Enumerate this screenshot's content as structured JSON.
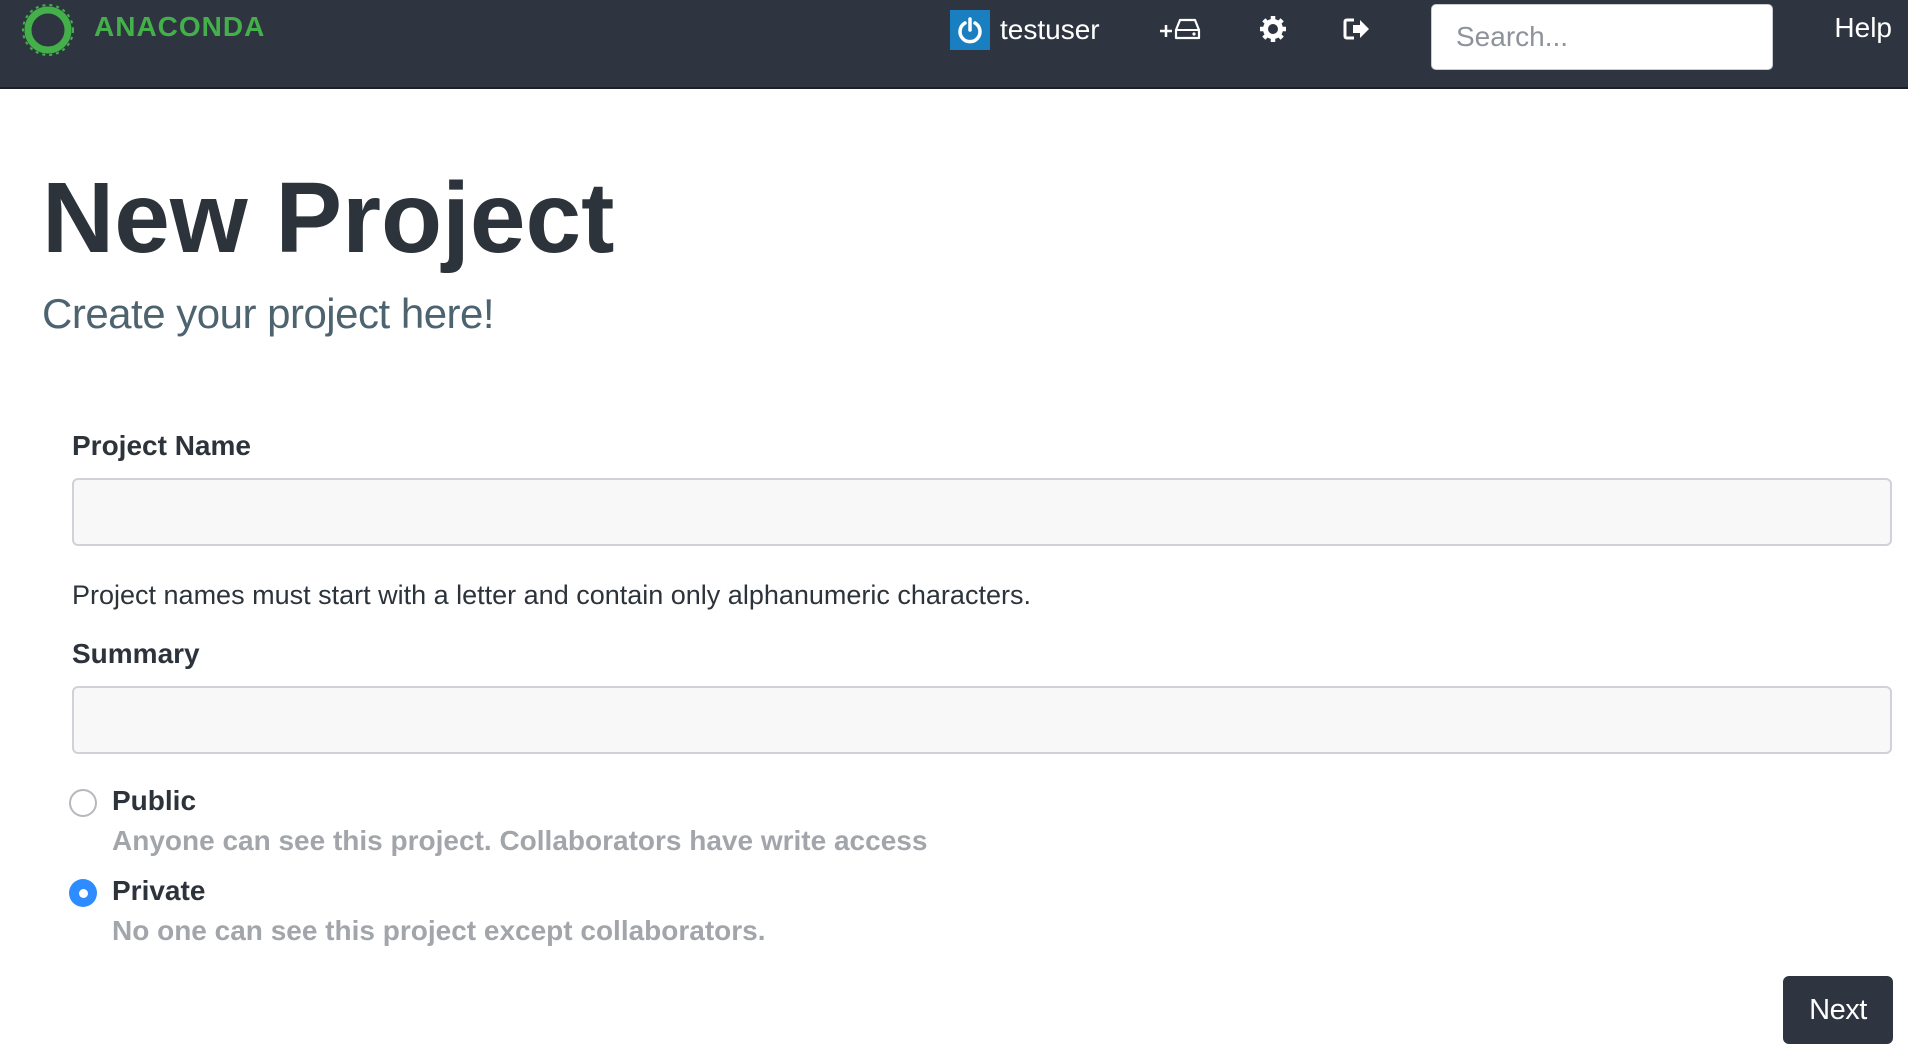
{
  "header": {
    "brand": "ANACONDA",
    "username": "testuser",
    "icons": {
      "logo": "anaconda-ring-logo",
      "avatar": "power-icon",
      "create": "add-drive-icon",
      "settings": "gear-icon",
      "logout": "sign-out-icon"
    },
    "search_placeholder": "Search...",
    "help_label": "Help"
  },
  "page": {
    "title": "New Project",
    "subtitle": "Create your project here!"
  },
  "form": {
    "project_name_label": "Project Name",
    "project_name_value": "",
    "project_name_help": "Project names must start with a letter and contain only alphanumeric characters.",
    "summary_label": "Summary",
    "summary_value": "",
    "visibility": [
      {
        "label": "Public",
        "description": "Anyone can see this project. Collaborators have write access",
        "selected": false
      },
      {
        "label": "Private",
        "description": "No one can see this project except collaborators.",
        "selected": true
      }
    ],
    "next_label": "Next"
  },
  "colors": {
    "navbar_bg": "#2e3541",
    "brand_green": "#43b049",
    "radio_selected": "#2d8cff",
    "avatar_blue": "#1a7fc0"
  }
}
